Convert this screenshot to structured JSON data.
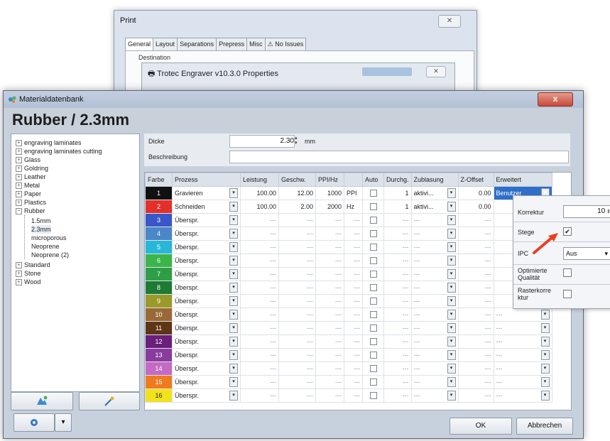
{
  "print_dialog": {
    "title": "Print",
    "tabs": [
      "General",
      "Layout",
      "Separations",
      "Prepress",
      "Misc",
      "No Issues"
    ],
    "destination_label": "Destination",
    "properties_title": "Trotec Engraver v10.3.0 Properties"
  },
  "window": {
    "title": "Materialdatenbank",
    "close_label": "x",
    "header": "Rubber / 2.3mm"
  },
  "tree": {
    "nodes": [
      "engraving laminates",
      "engraving laminates cutting",
      "Glass",
      "Goldring",
      "Leather",
      "Metal",
      "Paper",
      "Plastics",
      "Rubber"
    ],
    "rubber_children": [
      "1.5mm",
      "2.3mm",
      "microporous",
      "Neoprene",
      "Neoprene (2)"
    ],
    "after_nodes": [
      "Standard",
      "Stone",
      "Wood"
    ]
  },
  "properties": {
    "dicke_label": "Dicke",
    "dicke_value": "2.30",
    "dicke_unit": "mm",
    "beschreibung_label": "Beschreibung"
  },
  "table": {
    "headers": [
      "Farbe",
      "Prozess",
      "Leistung",
      "Geschw.",
      "PPI/Hz",
      "",
      "Auto",
      "Durchg.",
      "Zublasung",
      "Z-Offset",
      "Erweitert"
    ],
    "rows": [
      {
        "n": "1",
        "color": "#111111",
        "proc": "Gravieren",
        "leistung": "100.00",
        "geschw": "12.00",
        "ppi": "1000",
        "unit": "PPI",
        "durchg": "1",
        "zub": "aktivi...",
        "zoff": "0.00",
        "erw": "Benutzer"
      },
      {
        "n": "2",
        "color": "#e4302a",
        "proc": "Schneiden",
        "leistung": "100.00",
        "geschw": "2.00",
        "ppi": "2000",
        "unit": "Hz",
        "durchg": "1",
        "zub": "aktivi...",
        "zoff": "0.00",
        "erw": ""
      },
      {
        "n": "3",
        "color": "#3a57c8",
        "proc": "Überspr.",
        "leistung": "---",
        "geschw": "---",
        "ppi": "---",
        "unit": "---",
        "durchg": "---",
        "zub": "---",
        "zoff": "---",
        "erw": ""
      },
      {
        "n": "4",
        "color": "#4b86c8",
        "proc": "Überspr.",
        "leistung": "---",
        "geschw": "---",
        "ppi": "---",
        "unit": "---",
        "durchg": "---",
        "zub": "---",
        "zoff": "---",
        "erw": ""
      },
      {
        "n": "5",
        "color": "#27b7d8",
        "proc": "Überspr.",
        "leistung": "---",
        "geschw": "---",
        "ppi": "---",
        "unit": "---",
        "durchg": "---",
        "zub": "---",
        "zoff": "---",
        "erw": ""
      },
      {
        "n": "6",
        "color": "#3bb54a",
        "proc": "Überspr.",
        "leistung": "---",
        "geschw": "---",
        "ppi": "---",
        "unit": "---",
        "durchg": "---",
        "zub": "---",
        "zoff": "---",
        "erw": ""
      },
      {
        "n": "7",
        "color": "#2e9e46",
        "proc": "Überspr.",
        "leistung": "---",
        "geschw": "---",
        "ppi": "---",
        "unit": "---",
        "durchg": "---",
        "zub": "---",
        "zoff": "---",
        "erw": ""
      },
      {
        "n": "8",
        "color": "#1f7a34",
        "proc": "Überspr.",
        "leistung": "---",
        "geschw": "---",
        "ppi": "---",
        "unit": "---",
        "durchg": "---",
        "zub": "---",
        "zoff": "---",
        "erw": ""
      },
      {
        "n": "9",
        "color": "#9a9a2b",
        "proc": "Überspr.",
        "leistung": "---",
        "geschw": "---",
        "ppi": "---",
        "unit": "---",
        "durchg": "---",
        "zub": "---",
        "zoff": "---",
        "erw": ""
      },
      {
        "n": "10",
        "color": "#9a6a36",
        "proc": "Überspr.",
        "leistung": "---",
        "geschw": "---",
        "ppi": "---",
        "unit": "---",
        "durchg": "---",
        "zub": "---",
        "zoff": "---",
        "erw": "---"
      },
      {
        "n": "11",
        "color": "#5e3516",
        "proc": "Überspr.",
        "leistung": "---",
        "geschw": "---",
        "ppi": "---",
        "unit": "---",
        "durchg": "---",
        "zub": "---",
        "zoff": "---",
        "erw": "---"
      },
      {
        "n": "12",
        "color": "#6a1f7a",
        "proc": "Überspr.",
        "leistung": "---",
        "geschw": "---",
        "ppi": "---",
        "unit": "---",
        "durchg": "---",
        "zub": "---",
        "zoff": "---",
        "erw": "---"
      },
      {
        "n": "13",
        "color": "#8a3c9e",
        "proc": "Überspr.",
        "leistung": "---",
        "geschw": "---",
        "ppi": "---",
        "unit": "---",
        "durchg": "---",
        "zub": "---",
        "zoff": "---",
        "erw": "---"
      },
      {
        "n": "14",
        "color": "#c46ac4",
        "proc": "Überspr.",
        "leistung": "---",
        "geschw": "---",
        "ppi": "---",
        "unit": "---",
        "durchg": "---",
        "zub": "---",
        "zoff": "---",
        "erw": "---"
      },
      {
        "n": "15",
        "color": "#f07a20",
        "proc": "Überspr.",
        "leistung": "---",
        "geschw": "---",
        "ppi": "---",
        "unit": "---",
        "durchg": "---",
        "zub": "---",
        "zoff": "---",
        "erw": "---"
      },
      {
        "n": "16",
        "color": "#f2e21c",
        "proc": "Überspr.",
        "leistung": "---",
        "geschw": "---",
        "ppi": "---",
        "unit": "---",
        "durchg": "---",
        "zub": "---",
        "zoff": "---",
        "erw": "---"
      }
    ]
  },
  "popup": {
    "korrektur_label": "Korrektur",
    "korrektur_value": "10",
    "stege_label": "Stege",
    "ipc_label": "IPC",
    "ipc_value": "Aus",
    "optimierte_label": "Optimierte Qualität",
    "raster_label": "Rasterkorre ktur"
  },
  "buttons": {
    "ok": "OK",
    "cancel": "Abbrechen"
  },
  "colors": {
    "accent": "#2f6fc9",
    "arrow": "#e8401f"
  }
}
